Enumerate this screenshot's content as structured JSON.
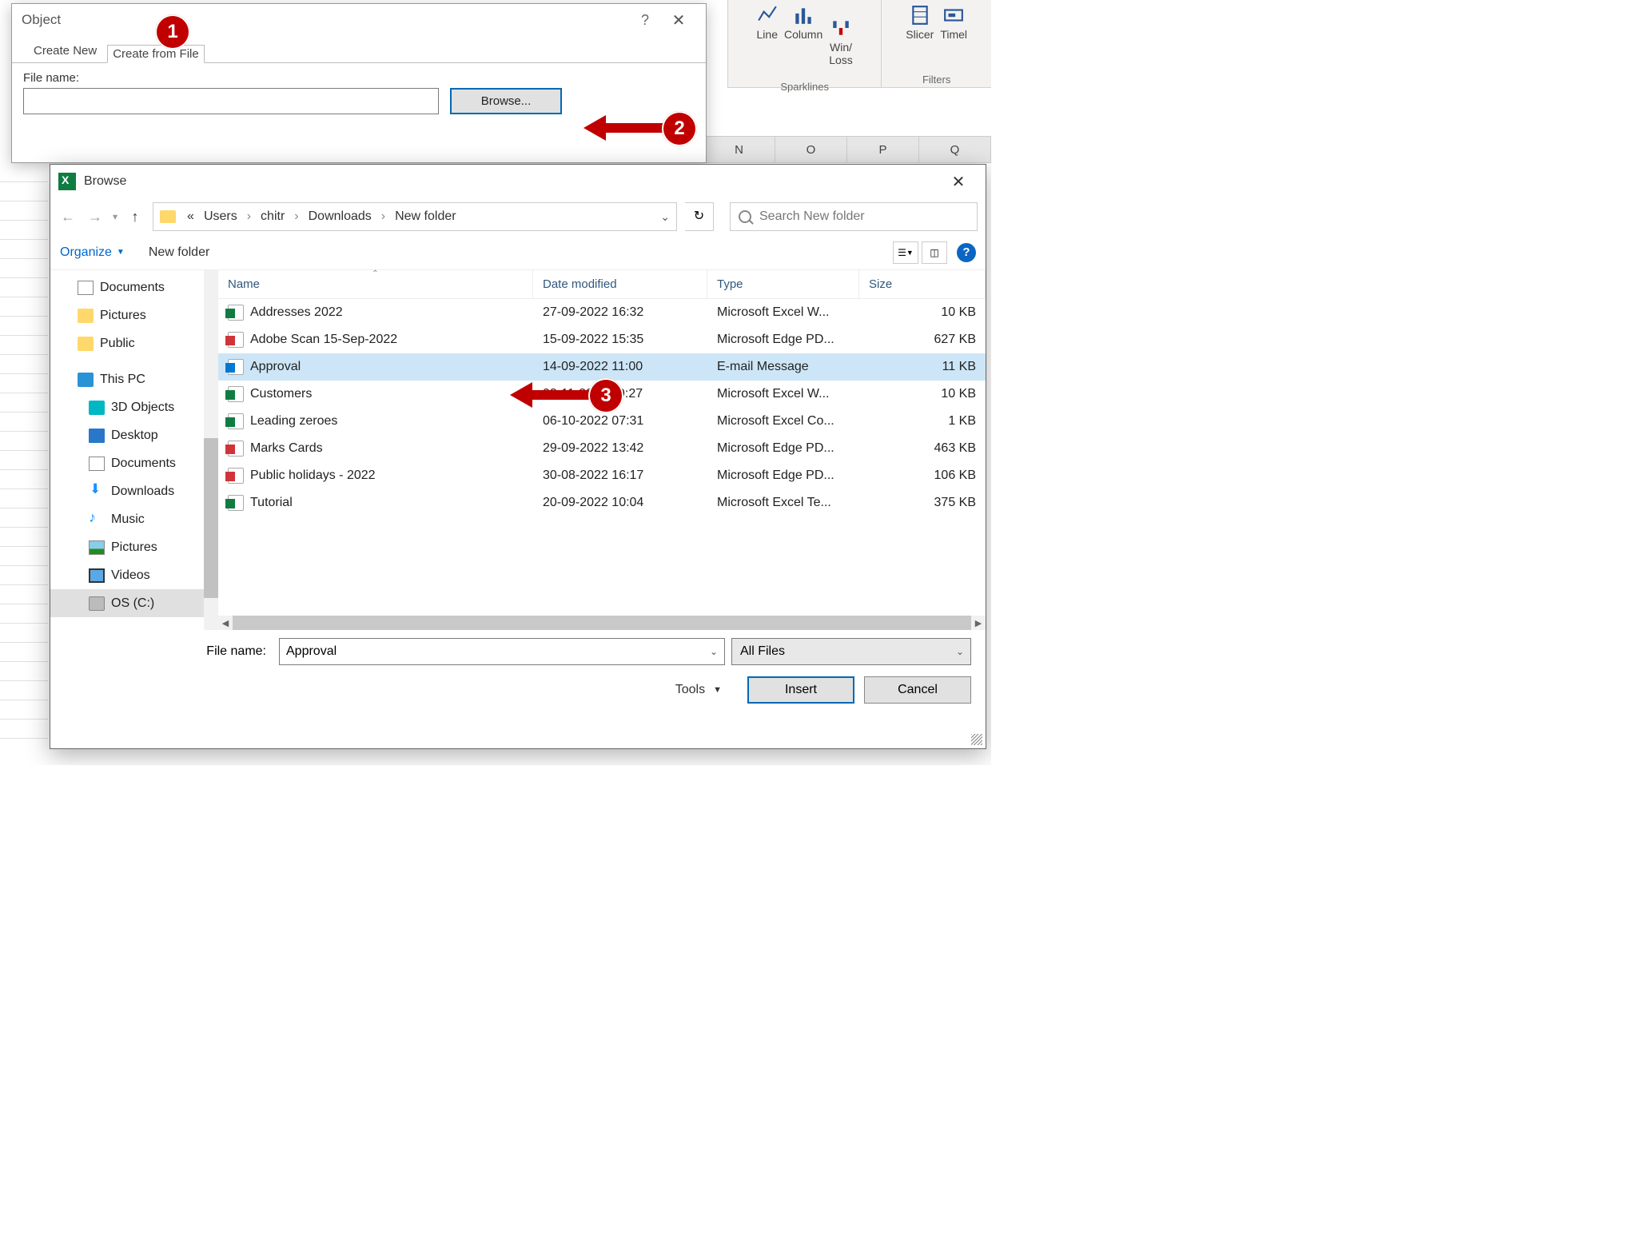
{
  "ribbon": {
    "sparklines": {
      "line": "Line",
      "column": "Column",
      "winloss": "Win/\nLoss",
      "group": "Sparklines"
    },
    "filters": {
      "slicer": "Slicer",
      "timeline": "Timel",
      "group": "Filters"
    }
  },
  "columns": [
    "N",
    "O",
    "P",
    "Q"
  ],
  "object_dialog": {
    "title": "Object",
    "tab_create_new": "Create New",
    "tab_create_from_file": "Create from File",
    "file_name_label": "File name:",
    "browse_btn": "Browse...",
    "help_glyph": "?",
    "close_glyph": "✕"
  },
  "browse_dialog": {
    "title": "Browse",
    "close_glyph": "✕",
    "breadcrumb_prefix": "«",
    "breadcrumb": [
      "Users",
      "chitr",
      "Downloads",
      "New folder"
    ],
    "refresh_glyph": "↻",
    "search_placeholder": "Search New folder",
    "organize": "Organize",
    "new_folder": "New folder",
    "tree": [
      {
        "icon": "doc",
        "label": "Documents",
        "indent": false
      },
      {
        "icon": "folder",
        "label": "Pictures",
        "indent": false
      },
      {
        "icon": "folder",
        "label": "Public",
        "indent": false
      },
      {
        "icon": "pc",
        "label": "This PC",
        "indent": false,
        "gap": true
      },
      {
        "icon": "3d",
        "label": "3D Objects",
        "indent": true
      },
      {
        "icon": "desktop",
        "label": "Desktop",
        "indent": true
      },
      {
        "icon": "doc",
        "label": "Documents",
        "indent": true
      },
      {
        "icon": "dl",
        "label": "Downloads",
        "indent": true
      },
      {
        "icon": "music",
        "label": "Music",
        "indent": true
      },
      {
        "icon": "pic",
        "label": "Pictures",
        "indent": true
      },
      {
        "icon": "vid",
        "label": "Videos",
        "indent": true
      },
      {
        "icon": "drive",
        "label": "OS (C:)",
        "indent": true,
        "selected": true
      }
    ],
    "cols": {
      "name": "Name",
      "date": "Date modified",
      "type": "Type",
      "size": "Size"
    },
    "files": [
      {
        "icon": "xls",
        "name": "Addresses 2022",
        "date": "27-09-2022 16:32",
        "type": "Microsoft Excel W...",
        "size": "10 KB"
      },
      {
        "icon": "pdf",
        "name": "Adobe Scan 15-Sep-2022",
        "date": "15-09-2022 15:35",
        "type": "Microsoft Edge PD...",
        "size": "627 KB"
      },
      {
        "icon": "msg",
        "name": "Approval",
        "date": "14-09-2022 11:00",
        "type": "E-mail Message",
        "size": "11 KB",
        "selected": true
      },
      {
        "icon": "xls",
        "name": "Customers",
        "date": "03-11-2022 09:27",
        "type": "Microsoft Excel W...",
        "size": "10 KB"
      },
      {
        "icon": "xls",
        "name": "Leading zeroes",
        "date": "06-10-2022 07:31",
        "type": "Microsoft Excel Co...",
        "size": "1 KB"
      },
      {
        "icon": "pdf",
        "name": "Marks Cards",
        "date": "29-09-2022 13:42",
        "type": "Microsoft Edge PD...",
        "size": "463 KB"
      },
      {
        "icon": "pdf",
        "name": "Public holidays - 2022",
        "date": "30-08-2022 16:17",
        "type": "Microsoft Edge PD...",
        "size": "106 KB"
      },
      {
        "icon": "xls",
        "name": "Tutorial",
        "date": "20-09-2022 10:04",
        "type": "Microsoft Excel Te...",
        "size": "375 KB"
      }
    ],
    "file_name_label": "File name:",
    "file_name_value": "Approval",
    "filter": "All Files",
    "tools": "Tools",
    "insert": "Insert",
    "cancel": "Cancel"
  },
  "callouts": {
    "c1": "1",
    "c2": "2",
    "c3": "3"
  }
}
